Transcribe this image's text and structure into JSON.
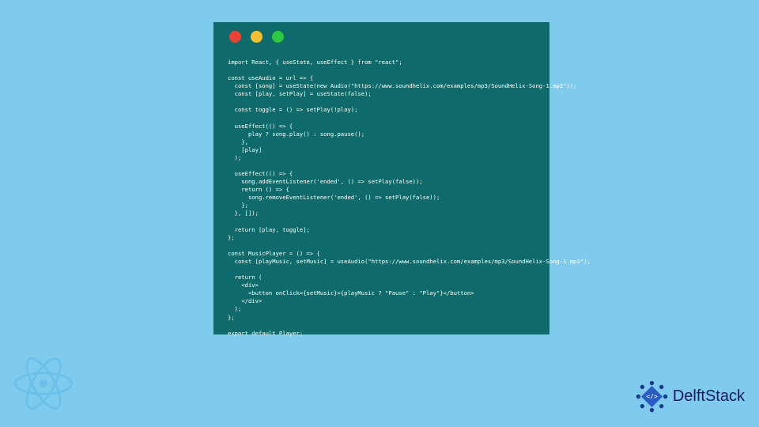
{
  "code_lines": [
    "import React, { useState, useEffect } from \"react\";",
    "",
    "const useAudio = url => {",
    "  const [song] = useState(new Audio(\"https://www.soundhelix.com/examples/mp3/SoundHelix-Song-1.mp3\"));",
    "  const [play, setPlay] = useState(false);",
    "",
    "  const toggle = () => setPlay(!play);",
    "",
    "  useEffect(() => {",
    "      play ? song.play() : song.pause();",
    "    },",
    "    [play]",
    "  );",
    "",
    "  useEffect(() => {",
    "    song.addEventListener('ended', () => setPlay(false));",
    "    return () => {",
    "      song.removeEventListener('ended', () => setPlay(false));",
    "    };",
    "  }, []);",
    "",
    "  return [play, toggle];",
    "};",
    "",
    "const MusicPlayer = () => {",
    "  const [playMusic, setMusic] = useAudio(\"https://www.soundhelix.com/examples/mp3/SoundHelix-Song-1.mp3\");",
    "",
    "  return (",
    "    <div>",
    "      <button onClick={setMusic}>{playMusic ? \"Pause\" : \"Play\"}</button>",
    "    </div>",
    "  );",
    "};",
    "",
    "export default Player;"
  ],
  "brand": {
    "name": "DelftStack"
  },
  "colors": {
    "bg": "#7fcbee",
    "window": "#0f6b6b",
    "brand_text": "#1a1a5e"
  }
}
